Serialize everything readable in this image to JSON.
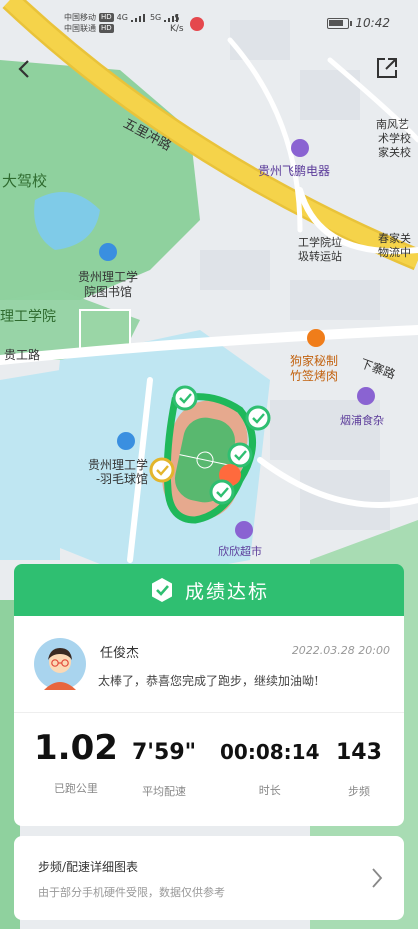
{
  "status_bar": {
    "carrier1": "中国移动",
    "carrier2": "中国联通",
    "hd": "HD",
    "net1": "4G",
    "net2": "5G",
    "speed_value": "5",
    "speed_unit": "K/s",
    "time": "10:42"
  },
  "map": {
    "labels": {
      "road_wulichong": "五里冲路",
      "school_big": "大驾校",
      "library_1": "贵州理工学",
      "library_2": "院图书馆",
      "feipeng": "贵州飞鹏电器",
      "station_1": "工学院垃",
      "station_2": "圾转运站",
      "nanfeng_1": "南风艺",
      "nanfeng_2": "术学校",
      "nanfeng_3": "家关校",
      "chunjia_1": "春家关",
      "chunjia_2": "物流中",
      "ligong_left": "理工学院",
      "guigong_road": "贵工路",
      "bbq_1": "狗家秘制",
      "bbq_2": "竹签烤肉",
      "xiazhai_road": "下寨路",
      "yanpu": "烟浦食杂",
      "badminton_1": "贵州理工学",
      "badminton_2": "-羽毛球馆",
      "xinxin": "欣欣超市"
    }
  },
  "card": {
    "title": "成绩达标",
    "username": "任俊杰",
    "datetime": "2022.03.28  20:00",
    "message": "太棒了，恭喜您完成了跑步，继续加油呦!",
    "stats": [
      {
        "value": "1.02",
        "label": "已跑公里"
      },
      {
        "value": "7'59\"",
        "label": "平均配速"
      },
      {
        "value": "00:08:14",
        "label": "时长"
      },
      {
        "value": "143",
        "label": "步频"
      }
    ]
  },
  "detail": {
    "title": "步频/配速详细图表",
    "subtitle": "由于部分手机硬件受限，数据仅供参考"
  },
  "colors": {
    "accent": "#2fbf71",
    "road_yellow": "#f5d34a",
    "water": "#9fdcf0",
    "park": "#8fd19e"
  }
}
